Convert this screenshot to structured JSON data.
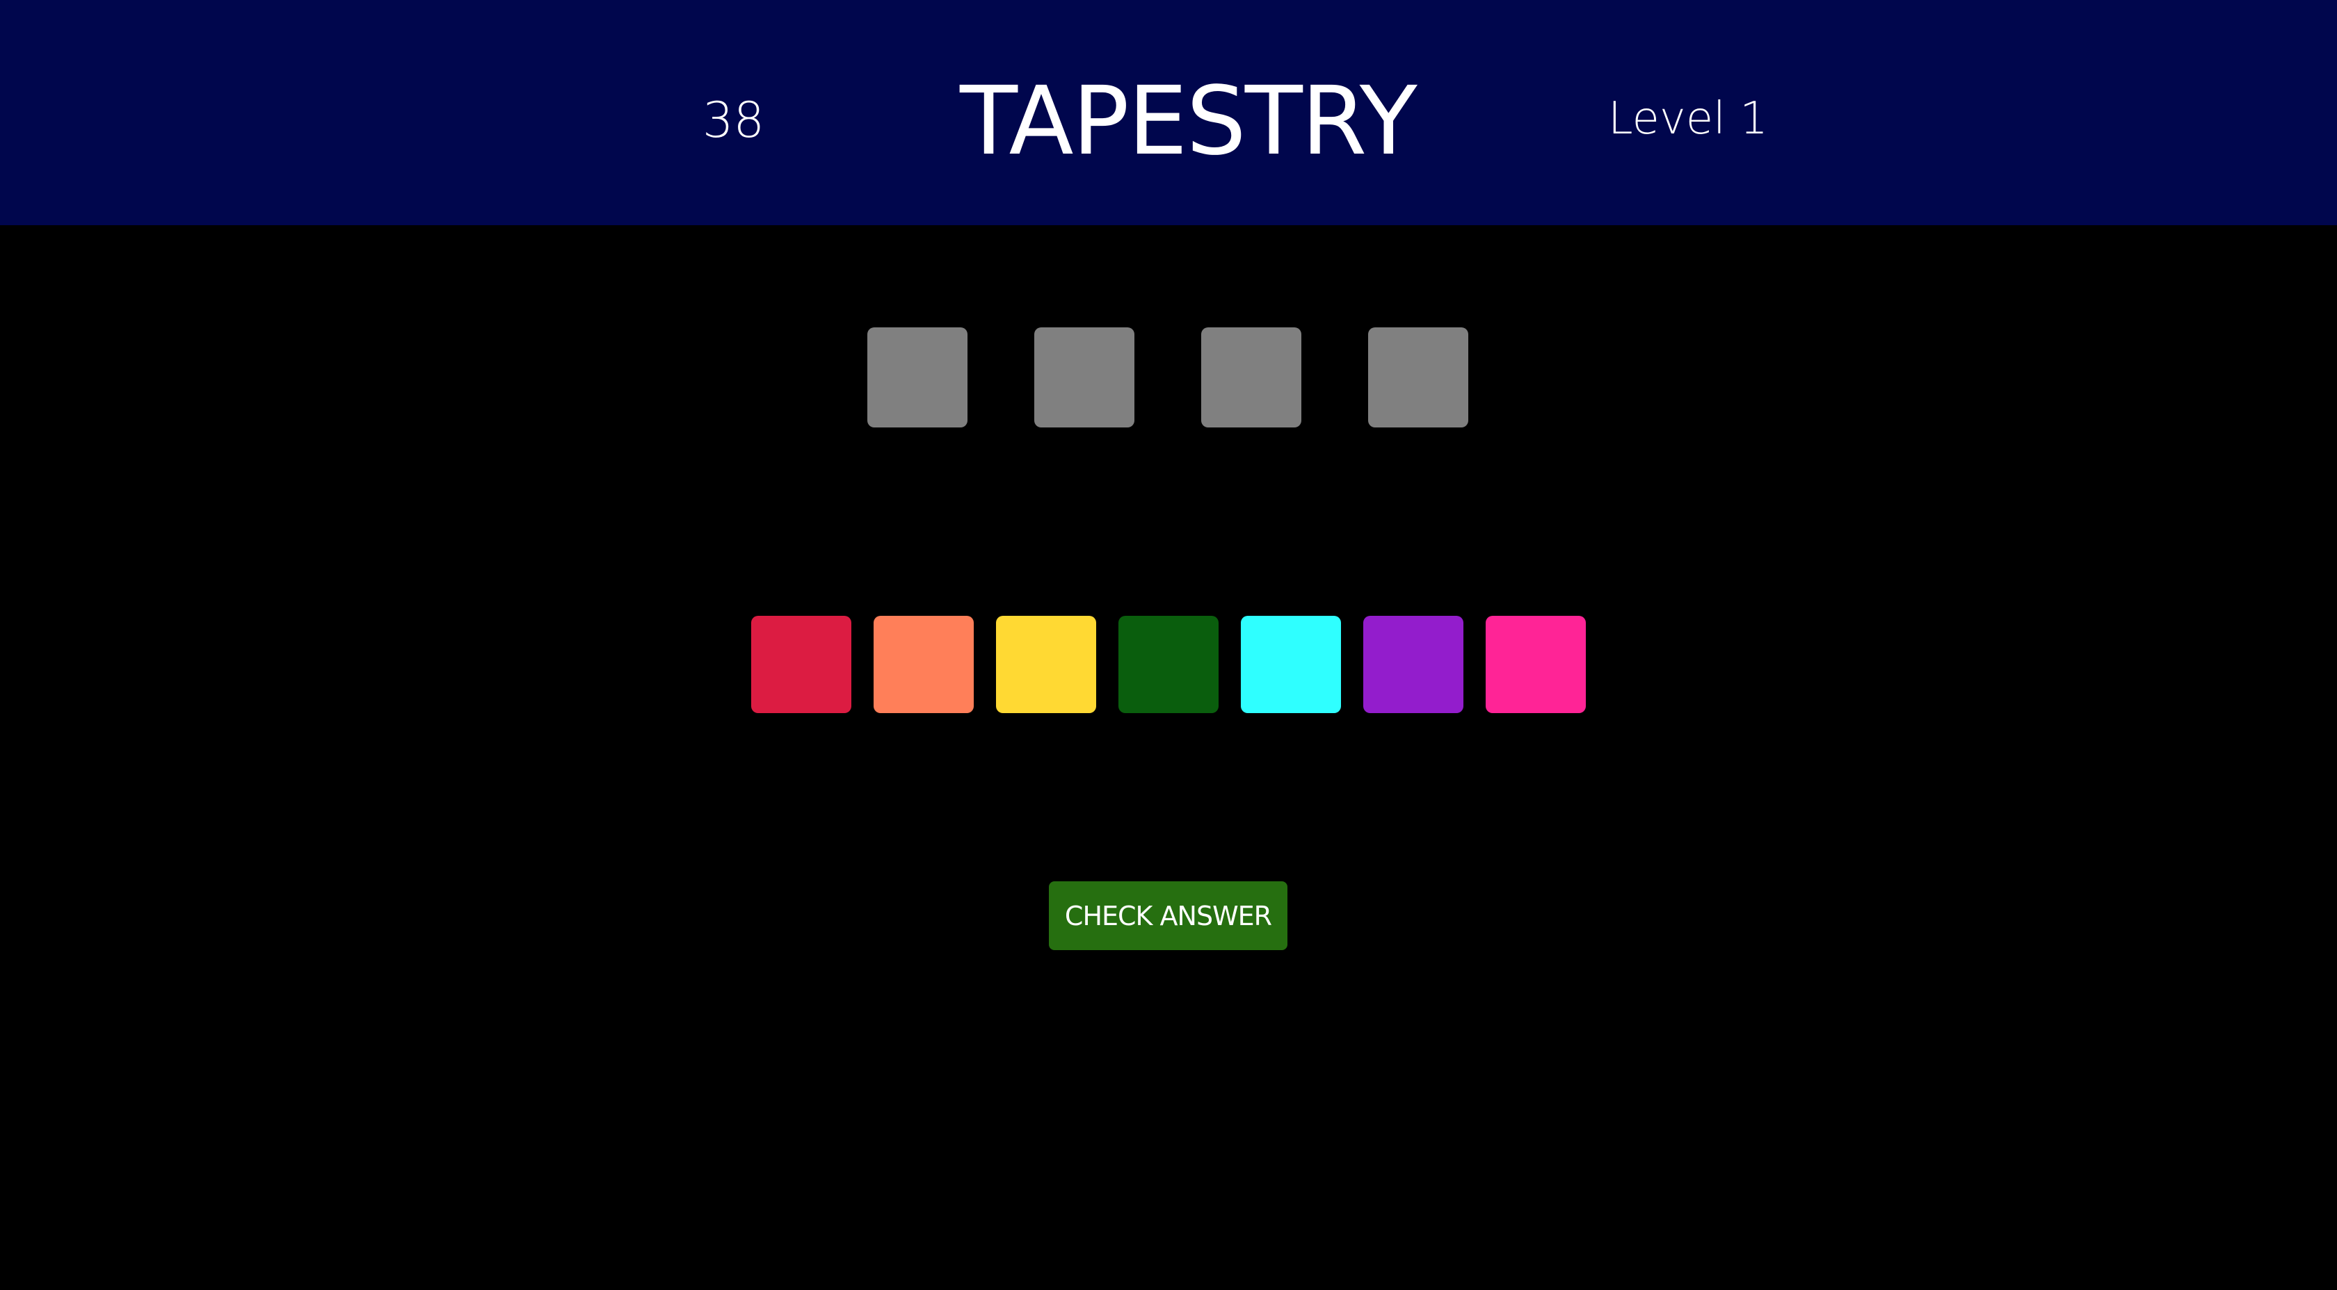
{
  "header": {
    "score": "38",
    "title": "TAPESTRY",
    "level": "Level 1"
  },
  "answer_slots": [
    {
      "color": "#808080"
    },
    {
      "color": "#808080"
    },
    {
      "color": "#808080"
    },
    {
      "color": "#808080"
    }
  ],
  "palette": [
    {
      "name": "crimson",
      "color": "#dc1c42"
    },
    {
      "name": "coral",
      "color": "#ff7f59"
    },
    {
      "name": "yellow",
      "color": "#ffd933"
    },
    {
      "name": "dark-green",
      "color": "#0a5e0d"
    },
    {
      "name": "cyan",
      "color": "#2fffff"
    },
    {
      "name": "purple",
      "color": "#931dcc"
    },
    {
      "name": "pink",
      "color": "#ff2496"
    }
  ],
  "check_button": {
    "label": "CHECK ANSWER",
    "color": "#266f10"
  },
  "colors": {
    "header_bg": "#00064d",
    "background": "#000000"
  }
}
